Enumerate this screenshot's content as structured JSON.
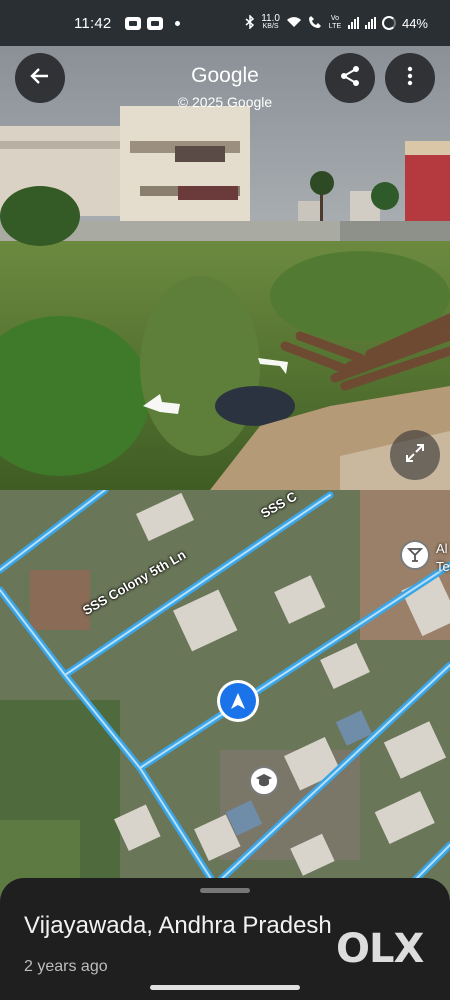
{
  "status_bar": {
    "time": "11:42",
    "network_speed": "11.0",
    "network_unit": "KB/S",
    "volte": "Vo LTE",
    "battery_percent": "44%"
  },
  "street_view": {
    "title": "Google",
    "copyright": "© 2025 Google",
    "back_icon": "arrow-back-icon",
    "share_icon": "share-icon",
    "more_icon": "more-vert-icon",
    "expand_icon": "expand-icon"
  },
  "map": {
    "street_label_1": "SSS Colony 5th Ln",
    "street_label_2": "SSS C",
    "poi_label_1": "Al",
    "poi_label_2": "Te",
    "road_color": "#3aa6e8",
    "location_marker_color": "#1a73e8"
  },
  "sheet": {
    "place": "Vijayawada, Andhra Pradesh",
    "age": "2 years ago"
  },
  "watermark": "OLX"
}
